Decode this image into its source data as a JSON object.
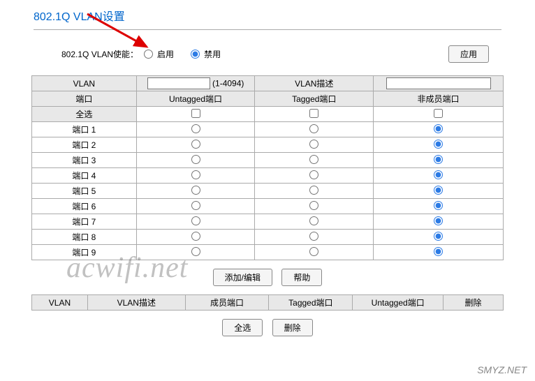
{
  "title": "802.1Q VLAN设置",
  "enable": {
    "label": "802.1Q VLAN使能：",
    "on": "启用",
    "off": "禁用",
    "apply": "应用"
  },
  "header1": {
    "vlan": "VLAN",
    "id_hint": "(1-4094)",
    "desc": "VLAN描述"
  },
  "header2": {
    "port": "端口",
    "untagged": "Untagged端口",
    "tagged": "Tagged端口",
    "nonmember": "非成员端口"
  },
  "select_all": "全选",
  "ports": [
    "端口 1",
    "端口 2",
    "端口 3",
    "端口 4",
    "端口 5",
    "端口 6",
    "端口 7",
    "端口 8",
    "端口 9"
  ],
  "actions": {
    "add_edit": "添加/编辑",
    "help": "帮助"
  },
  "list_header": {
    "vlan": "VLAN",
    "desc": "VLAN描述",
    "member": "成员端口",
    "tagged": "Tagged端口",
    "untagged": "Untagged端口",
    "delete": "删除"
  },
  "bottom": {
    "select_all": "全选",
    "delete": "删除"
  },
  "watermark": "acwifi.net",
  "watermark2": "SMYZ.NET"
}
